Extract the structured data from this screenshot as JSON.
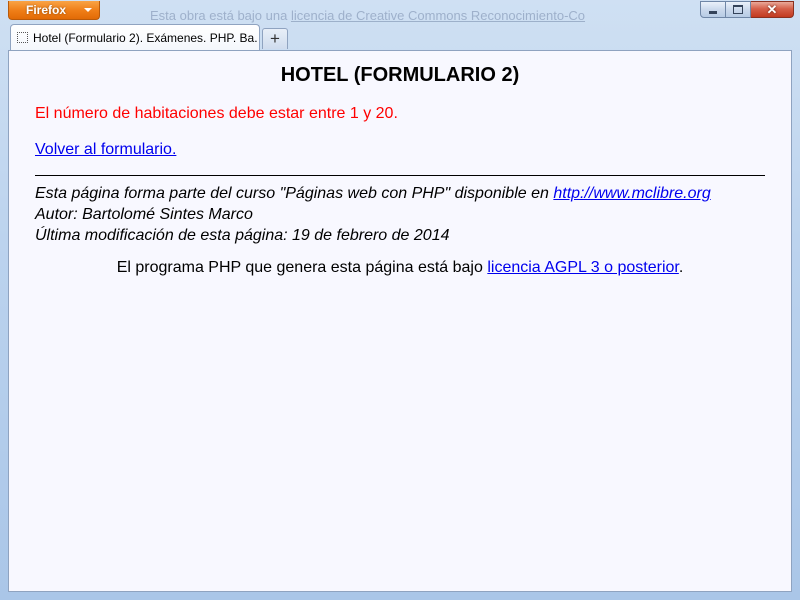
{
  "browser": {
    "menu_button_label": "Firefox",
    "background_text": {
      "prefix": "Esta obra está bajo una",
      "link": "licencia de Creative Commons Reconocimiento-Co"
    },
    "window_controls": {
      "minimize": "minimize",
      "maximize": "maximize",
      "close": "✕"
    },
    "tabs": [
      {
        "title": "Hotel (Formulario 2). Exámenes. PHP. Ba...",
        "active": true
      }
    ],
    "new_tab_label": "+"
  },
  "page": {
    "title": "HOTEL (FORMULARIO 2)",
    "error_message": "El número de habitaciones debe estar entre 1 y 20.",
    "back_link": "Volver al formulario.",
    "footer": {
      "course_text": "Esta página forma parte del curso \"Páginas web con PHP\" disponible en",
      "course_link": "http://www.mclibre.org",
      "author": "Autor: Bartolomé Sintes Marco",
      "last_modified": "Última modificación de esta página: 19 de febrero de 2014"
    },
    "license": {
      "text": "El programa PHP que genera esta página está bajo",
      "link": "licencia AGPL 3 o posterior",
      "suffix": "."
    }
  },
  "colors": {
    "error": "#ff0000",
    "link": "#0000ee",
    "page_background": "#f8f8ff",
    "firefox_button": "#ef7d16",
    "close_button": "#c23a20"
  },
  "icons": {
    "tab_favicon": "dotted-square-page-icon",
    "menu_arrow": "chevron-down-icon",
    "new_tab": "plus-icon"
  }
}
